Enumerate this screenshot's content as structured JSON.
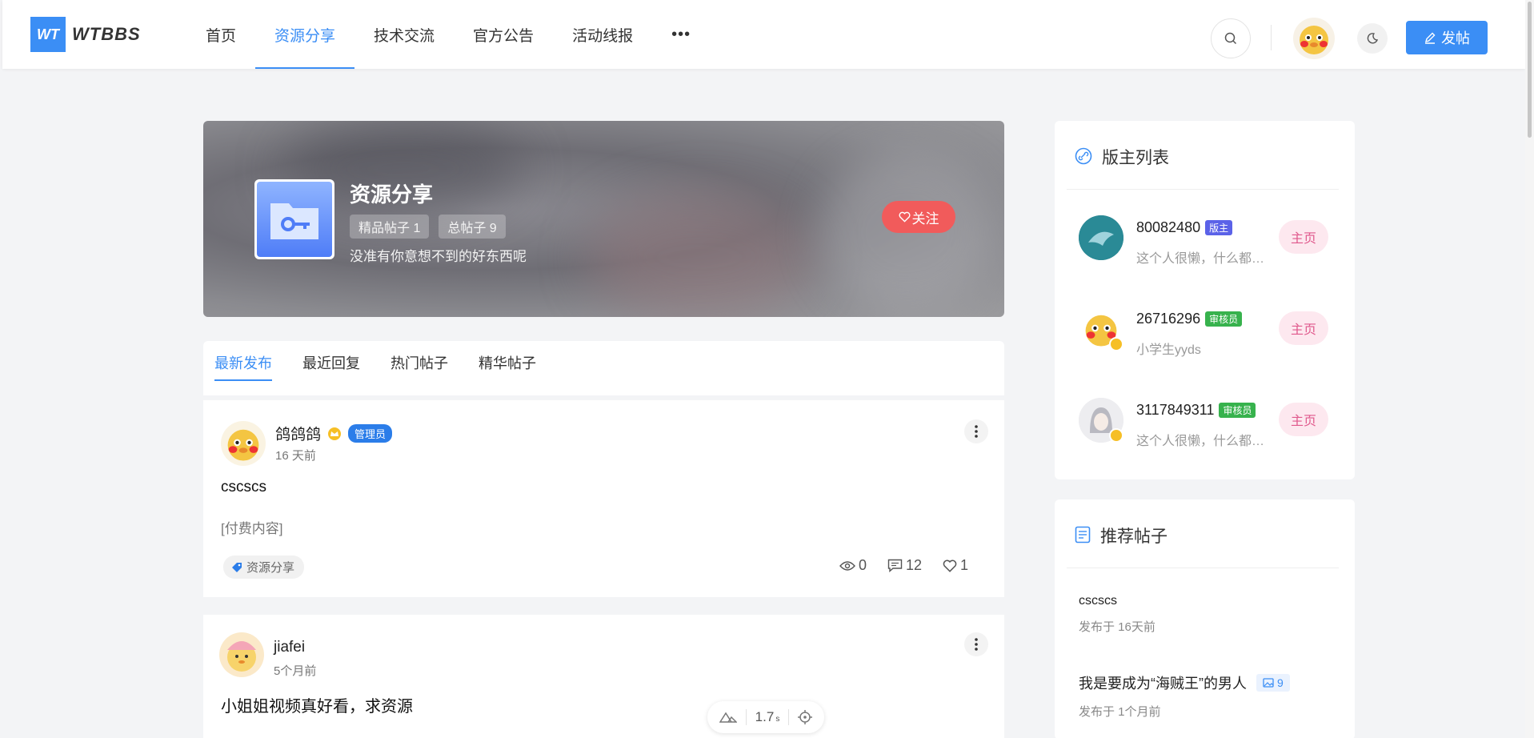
{
  "header": {
    "logo_mark": "WT",
    "logo_text": "WTBBS",
    "nav": [
      {
        "label": "首页",
        "active": false
      },
      {
        "label": "资源分享",
        "active": true
      },
      {
        "label": "技术交流",
        "active": false
      },
      {
        "label": "官方公告",
        "active": false
      },
      {
        "label": "活动线报",
        "active": false
      }
    ],
    "more_label": "•••",
    "post_button": "发帖"
  },
  "forum": {
    "title": "资源分享",
    "featured": "精品帖子 1",
    "total": "总帖子 9",
    "description": "没准有你意想不到的好东西呢",
    "follow": "关注"
  },
  "tabs": [
    {
      "label": "最新发布",
      "active": true
    },
    {
      "label": "最近回复",
      "active": false
    },
    {
      "label": "热门帖子",
      "active": false
    },
    {
      "label": "精华帖子",
      "active": false
    }
  ],
  "posts": [
    {
      "author": "鸽鸽鸽",
      "role": "管理员",
      "time": "16 天前",
      "title": "cscscs",
      "content": "[付费内容]",
      "tag": "资源分享",
      "views": "0",
      "comments": "12",
      "likes": "1"
    },
    {
      "author": "jiafei",
      "time": "5个月前",
      "title": "小姐姐视频真好看，求资源"
    }
  ],
  "moderators": {
    "title": "版主列表",
    "items": [
      {
        "id": "80082480",
        "badge": "版主",
        "badge_color": "#5b62e8",
        "desc": "这个人很懒，什么都没有留下",
        "home": "主页"
      },
      {
        "id": "26716296",
        "badge": "审核员",
        "badge_color": "#37b24d",
        "desc": "小学生yyds",
        "home": "主页"
      },
      {
        "id": "3117849311",
        "badge": "审核员",
        "badge_color": "#37b24d",
        "desc": "这个人很懒，什么都没有留下",
        "home": "主页"
      }
    ]
  },
  "recommended": {
    "title": "推荐帖子",
    "items": [
      {
        "title": "cscscs",
        "time": "发布于 16天前"
      },
      {
        "title": "我是要成为“海贼王”的男人",
        "images": "9",
        "time": "发布于 1个月前"
      }
    ]
  },
  "widget": {
    "value": "1.7",
    "unit": "s"
  },
  "colors": {
    "accent": "#3b8ef5",
    "follow": "#f15b5b",
    "home_pink": "#e0588c"
  }
}
